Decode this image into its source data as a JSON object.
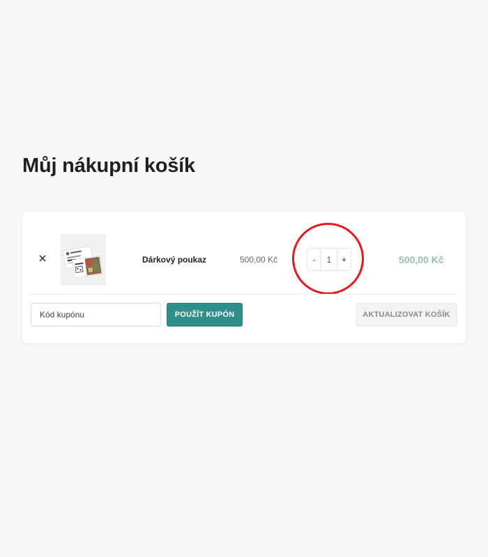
{
  "page": {
    "title": "Můj nákupní košík"
  },
  "cart": {
    "items": [
      {
        "name": "Dárkový poukaz",
        "price": "500,00 Kč",
        "quantity": "1",
        "subtotal": "500,00 Kč",
        "remove_icon": "close-icon",
        "thumbnail": "gift-voucher-image"
      }
    ],
    "quantity_decrement_label": "-",
    "quantity_increment_label": "+"
  },
  "coupon": {
    "placeholder": "Kód kupónu",
    "value": "",
    "apply_label": "POUŽÍT KUPÓN"
  },
  "actions": {
    "update_cart_label": "AKTUALIZOVAT KOŠÍK"
  },
  "colors": {
    "background": "#f8f8f8",
    "card": "#ffffff",
    "accent": "#2e9089",
    "subtotal": "#92bfaf",
    "highlight": "#e5181d"
  }
}
